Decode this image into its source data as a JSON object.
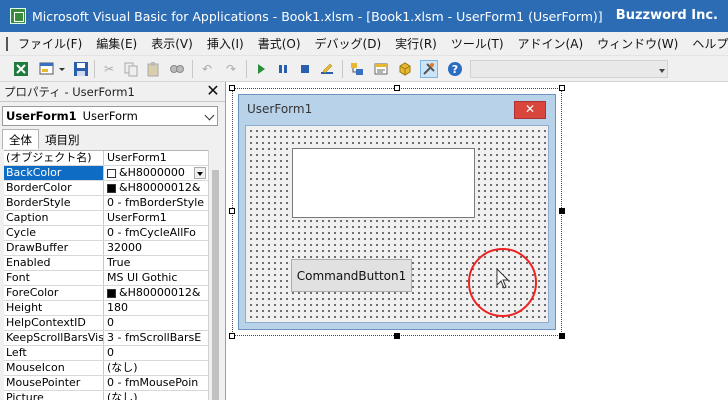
{
  "window": {
    "title": "Microsoft Visual Basic for Applications - Book1.xlsm - [Book1.xlsm - UserForm1 (UserForm)]",
    "brand": "Buzzword Inc."
  },
  "menu": [
    "ファイル(F)",
    "編集(E)",
    "表示(V)",
    "挿入(I)",
    "書式(O)",
    "デバッグ(D)",
    "実行(R)",
    "ツール(T)",
    "アドイン(A)",
    "ウィンドウ(W)",
    "ヘルプ(H)"
  ],
  "toolbar": {
    "icons": [
      "excel-icon",
      "insert-userform-icon",
      "save-icon",
      "cut-icon",
      "copy-icon",
      "paste-icon",
      "find-icon",
      "undo-icon",
      "redo-icon",
      "run-icon",
      "pause-icon",
      "reset-icon",
      "design-mode-icon",
      "project-explorer-icon",
      "properties-icon",
      "object-browser-icon",
      "toolbox-icon",
      "help-icon"
    ],
    "selected": "toolbox-icon"
  },
  "properties": {
    "panel_title": "プロパティ - UserForm1",
    "object_name": "UserForm1",
    "object_type": "UserForm",
    "tabs": [
      "全体",
      "項目別"
    ],
    "rows": [
      {
        "name": "(オブジェクト名)",
        "value": "UserForm1"
      },
      {
        "name": "BackColor",
        "value": "&H8000000",
        "swatch": "#ffffff",
        "selected": true,
        "dropdown": true
      },
      {
        "name": "BorderColor",
        "value": "&H80000012&",
        "swatch": "#000000"
      },
      {
        "name": "BorderStyle",
        "value": "0 - fmBorderStyle"
      },
      {
        "name": "Caption",
        "value": "UserForm1"
      },
      {
        "name": "Cycle",
        "value": "0 - fmCycleAllFo"
      },
      {
        "name": "DrawBuffer",
        "value": "32000"
      },
      {
        "name": "Enabled",
        "value": "True"
      },
      {
        "name": "Font",
        "value": "MS UI Gothic"
      },
      {
        "name": "ForeColor",
        "value": "&H80000012&",
        "swatch": "#000000"
      },
      {
        "name": "Height",
        "value": "180"
      },
      {
        "name": "HelpContextID",
        "value": "0"
      },
      {
        "name": "KeepScrollBarsVis",
        "value": "3 - fmScrollBarsE"
      },
      {
        "name": "Left",
        "value": "0"
      },
      {
        "name": "MouseIcon",
        "value": "(なし)"
      },
      {
        "name": "MousePointer",
        "value": "0 - fmMousePoin"
      },
      {
        "name": "Picture",
        "value": "(なし)"
      }
    ]
  },
  "userform": {
    "caption": "UserForm1",
    "close_label": "✕",
    "button_label": "CommandButton1"
  }
}
